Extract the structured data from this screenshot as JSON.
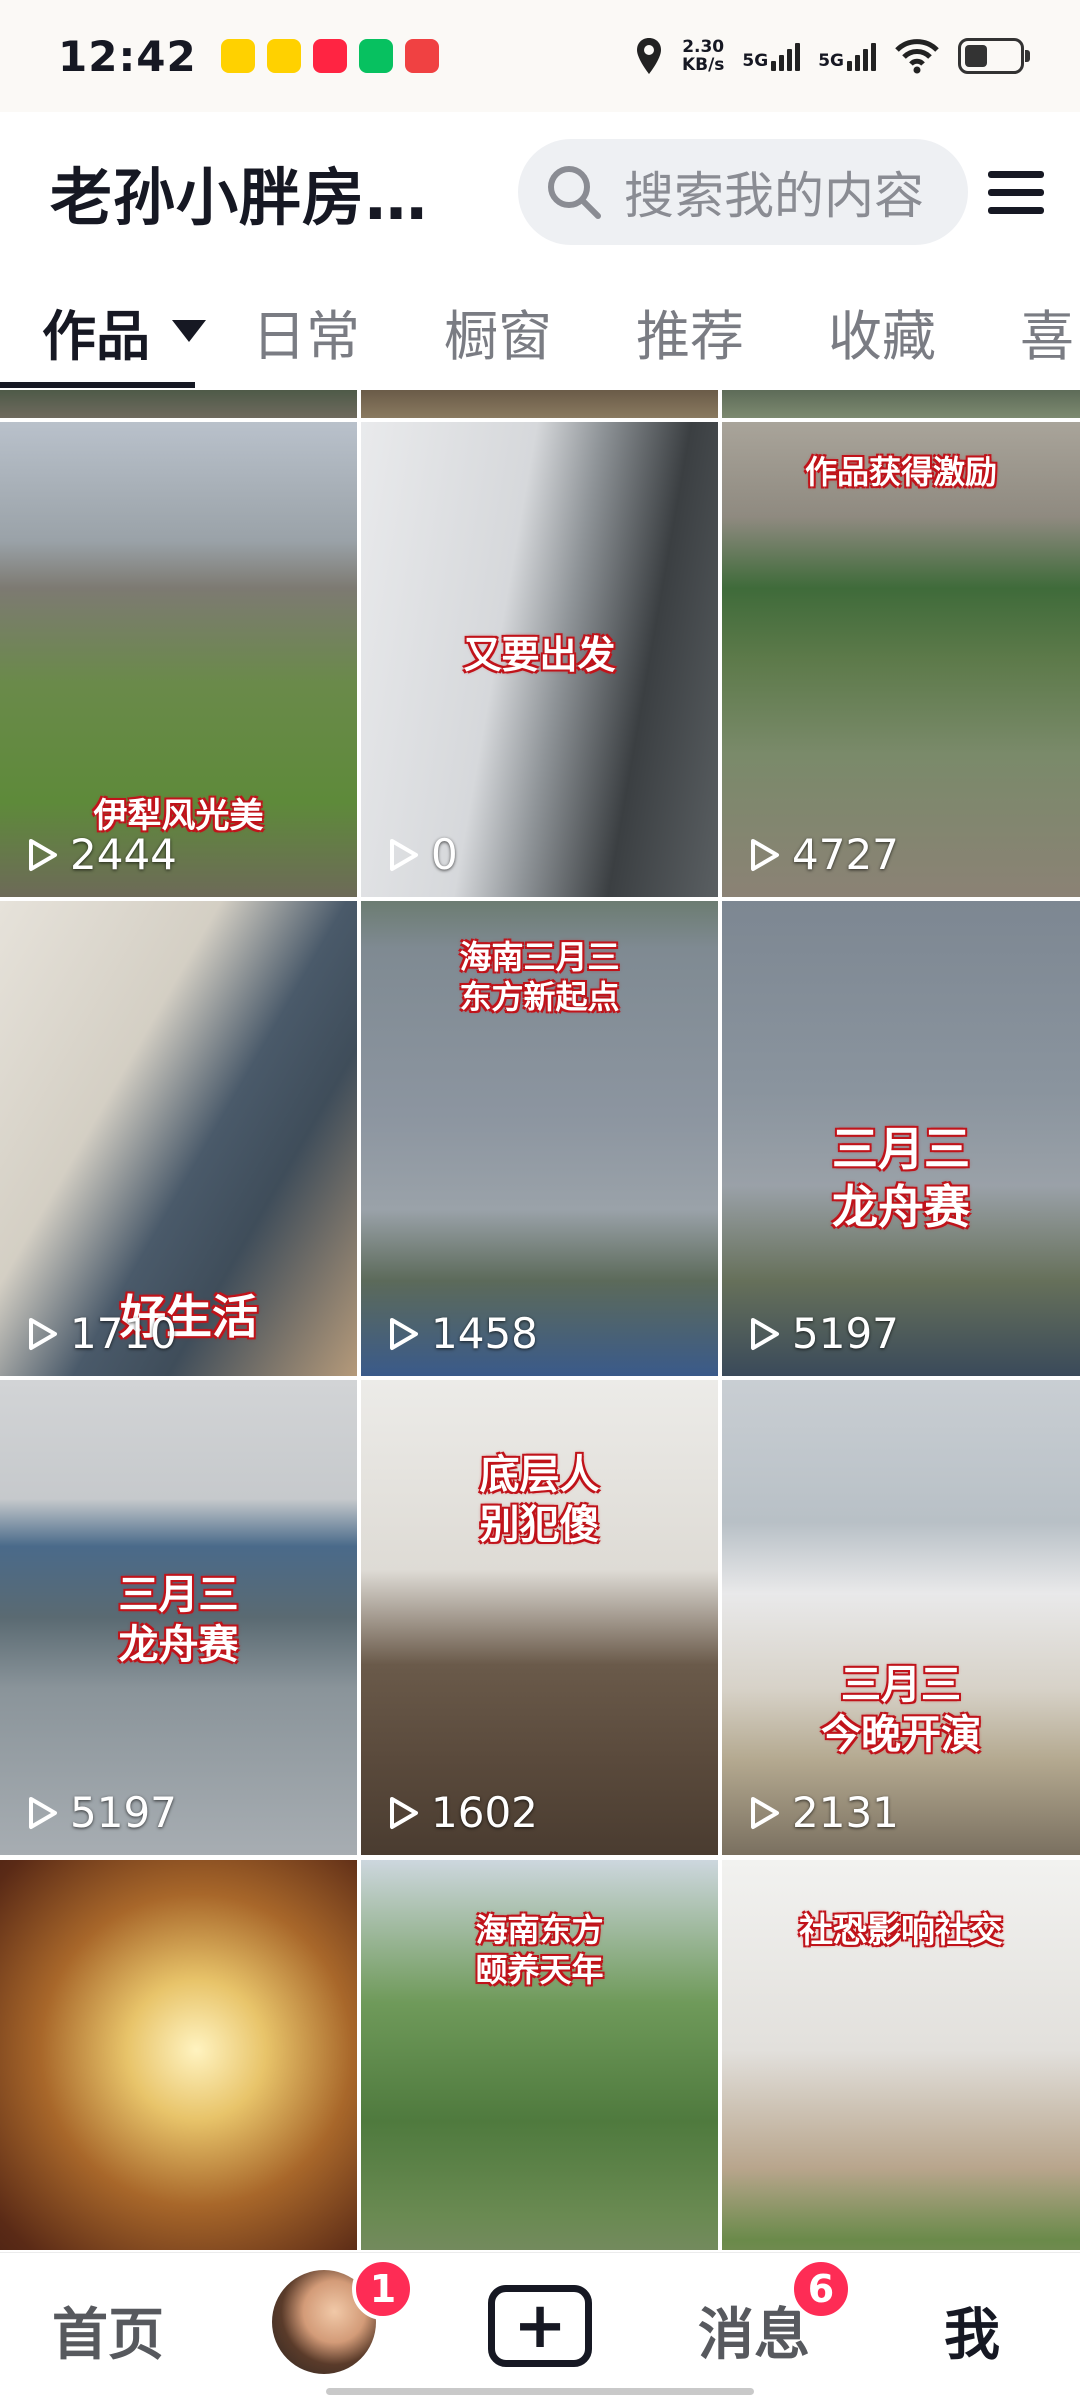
{
  "status_bar": {
    "time": "12:42",
    "apps": [
      {
        "name": "美团",
        "color": "#ffd100"
      },
      {
        "name": "美团",
        "color": "#ffd100"
      },
      {
        "name": "小红书",
        "color": "#ff2442"
      },
      {
        "name": "微信",
        "color": "#07c160"
      },
      {
        "name": "头条",
        "color": "#f04142"
      }
    ],
    "net_speed_value": "2.30",
    "net_speed_unit": "KB/s",
    "signal_1": "5G",
    "signal_2": "5G"
  },
  "header": {
    "title": "老孙小胖房…",
    "search_placeholder": "搜索我的内容"
  },
  "tabs": [
    {
      "label": "作品",
      "active": true
    },
    {
      "label": "日常"
    },
    {
      "label": "橱窗"
    },
    {
      "label": "推荐"
    },
    {
      "label": "收藏"
    },
    {
      "label": "喜"
    }
  ],
  "videos": [
    {
      "caption": "伊犁风光美",
      "plays": "2444"
    },
    {
      "caption": "又要出发",
      "plays": "0"
    },
    {
      "caption": "作品获得激励",
      "plays": "4727"
    },
    {
      "caption": "好生活",
      "plays": "1710"
    },
    {
      "caption": "海南三月三\n东方新起点",
      "plays": "1458"
    },
    {
      "caption": "三月三\n龙舟赛",
      "plays": "5197"
    },
    {
      "caption": "三月三\n龙舟赛",
      "plays": ""
    },
    {
      "caption": "底层人\n别犯傻",
      "plays": "1602"
    },
    {
      "caption": "三月三\n今晚开演",
      "plays": "2131"
    },
    {
      "caption": "",
      "plays": ""
    },
    {
      "caption": "海南东方\n颐养天年",
      "plays": ""
    },
    {
      "caption": "社恐影响社交",
      "plays": ""
    }
  ],
  "bottom_nav": {
    "home": "首页",
    "friends_badge": "1",
    "messages": "消息",
    "messages_badge": "6",
    "me": "我"
  }
}
